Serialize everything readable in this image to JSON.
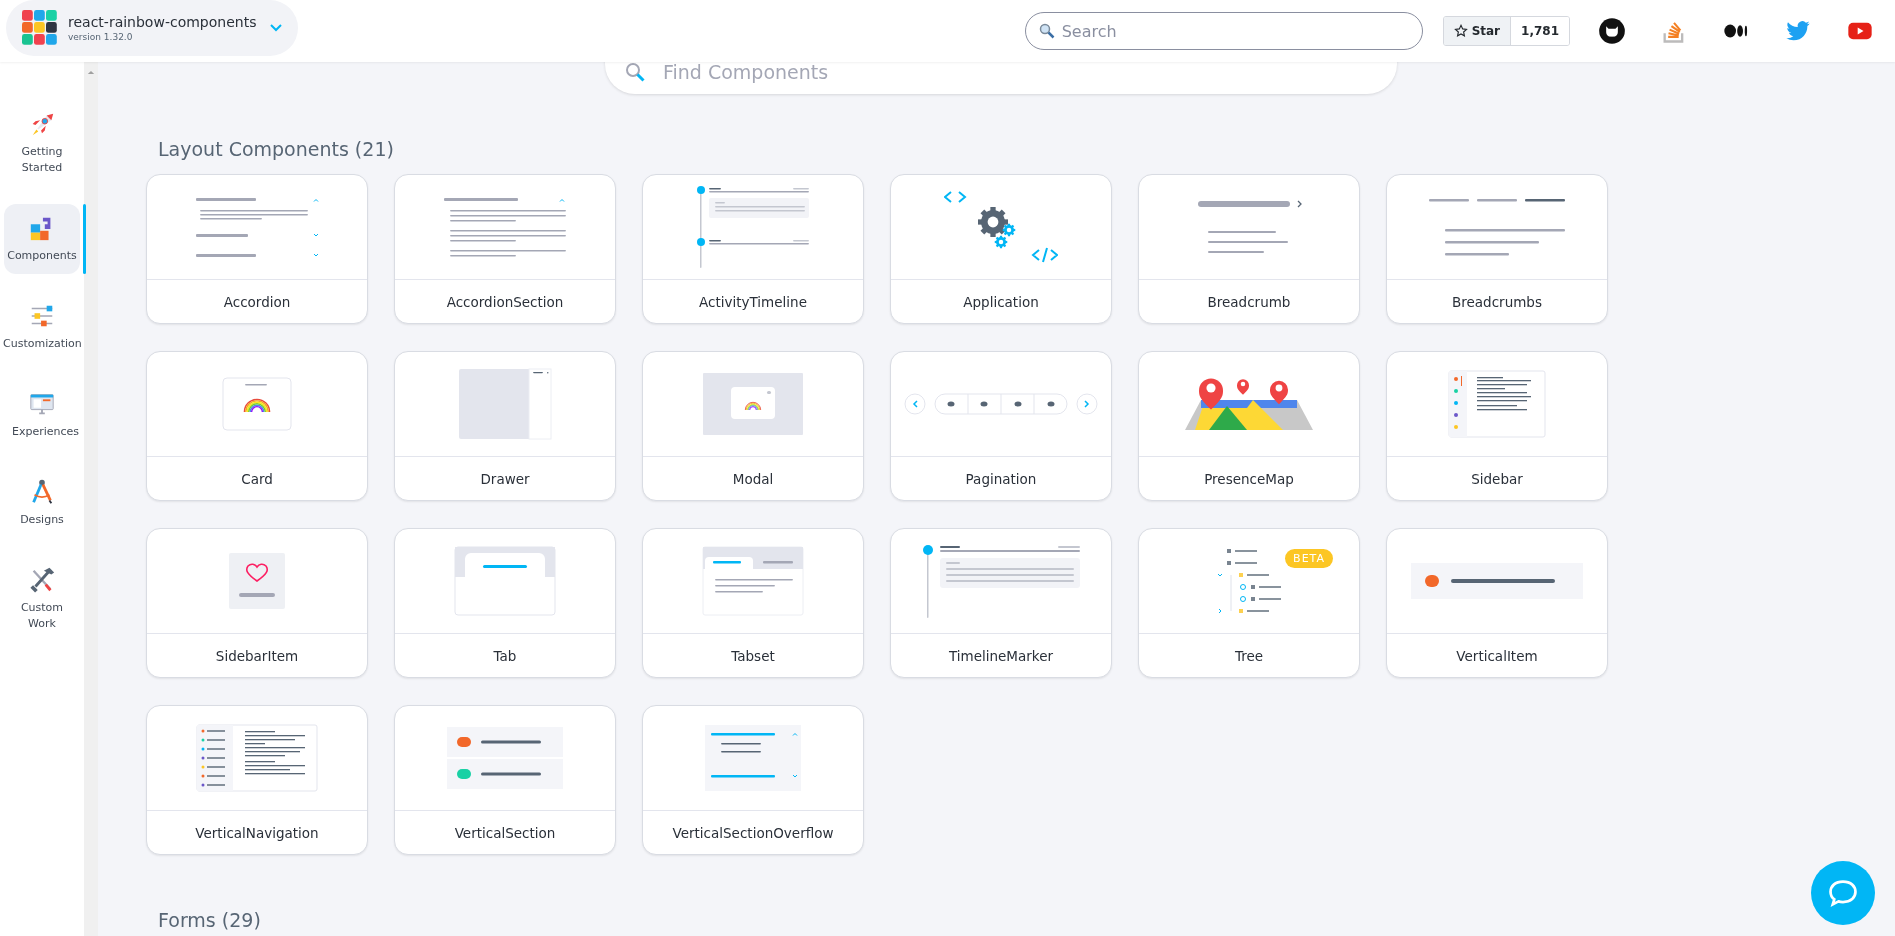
{
  "header": {
    "app_name": "react-rainbow-components",
    "version": "version 1.32.0",
    "search": {
      "placeholder": "Search"
    },
    "star": {
      "label": "Star",
      "count": "1,781"
    }
  },
  "nav": [
    {
      "label": "Getting Started",
      "kind": "rocket",
      "selected": false
    },
    {
      "label": "Components",
      "kind": "puzzle",
      "selected": true
    },
    {
      "label": "Customization",
      "kind": "sliders",
      "selected": false
    },
    {
      "label": "Experiences",
      "kind": "monitor",
      "selected": false
    },
    {
      "label": "Designs",
      "kind": "compass",
      "selected": false
    },
    {
      "label": "Custom Work",
      "kind": "tools",
      "selected": false
    }
  ],
  "find": {
    "placeholder": "Find Components"
  },
  "layout_section": {
    "title": "Layout Components (21)",
    "cards": [
      {
        "label": "Accordion",
        "kind": "accordion"
      },
      {
        "label": "AccordionSection",
        "kind": "accordionsection"
      },
      {
        "label": "ActivityTimeline",
        "kind": "timeline"
      },
      {
        "label": "Application",
        "kind": "gears"
      },
      {
        "label": "Breadcrumb",
        "kind": "breadcrumb"
      },
      {
        "label": "Breadcrumbs",
        "kind": "breadcrumbs"
      },
      {
        "label": "Card",
        "kind": "card"
      },
      {
        "label": "Drawer",
        "kind": "drawer"
      },
      {
        "label": "Modal",
        "kind": "modal"
      },
      {
        "label": "Pagination",
        "kind": "pagination"
      },
      {
        "label": "PresenceMap",
        "kind": "map"
      },
      {
        "label": "Sidebar",
        "kind": "sidebar"
      },
      {
        "label": "SidebarItem",
        "kind": "heart"
      },
      {
        "label": "Tab",
        "kind": "tab"
      },
      {
        "label": "Tabset",
        "kind": "tabset"
      },
      {
        "label": "TimelineMarker",
        "kind": "marker"
      },
      {
        "label": "Tree",
        "kind": "tree",
        "badge": "BETA"
      },
      {
        "label": "VerticalItem",
        "kind": "item"
      },
      {
        "label": "VerticalNavigation",
        "kind": "nav"
      },
      {
        "label": "VerticalSection",
        "kind": "section"
      },
      {
        "label": "VerticalSectionOverflow",
        "kind": "overflow"
      }
    ]
  },
  "next_section": {
    "title": "Forms (29)"
  }
}
